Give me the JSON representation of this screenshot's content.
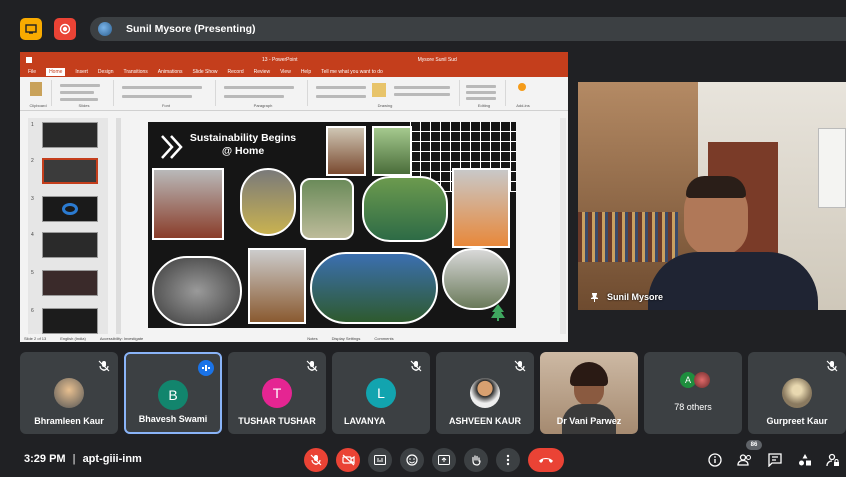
{
  "presenting_bar": {
    "title": "Sunil Mysore (Presenting)"
  },
  "powerpoint": {
    "title": "13 - PowerPoint",
    "user": "Mysore Sunil Sud",
    "menu": [
      "File",
      "Home",
      "Insert",
      "Design",
      "Transitions",
      "Animations",
      "Slide Show",
      "Record",
      "Review",
      "View",
      "Help",
      "Tell me what you want to do"
    ],
    "active_menu": "Home",
    "ribbon_groups": [
      "Clipboard",
      "Slides",
      "Font",
      "Paragraph",
      "Drawing",
      "Editing",
      "Add-ins"
    ],
    "slide_numbers": [
      "1",
      "2",
      "3",
      "4",
      "5",
      "6"
    ],
    "slide_title": "Sustainability Begins @ Home",
    "status": [
      "Slide 2 of 13",
      "English (India)",
      "Accessibility: Investigate",
      "Notes",
      "Display Settings",
      "Comments"
    ]
  },
  "presenter": {
    "name": "Sunil Mysore"
  },
  "participants": [
    {
      "name": "Bhramleen Kaur",
      "initial": "",
      "avatar_color": "#6d6d6d",
      "muted": true,
      "speaking": false
    },
    {
      "name": "Bhavesh Swami",
      "initial": "B",
      "avatar_color": "#12856d",
      "muted": false,
      "speaking": true
    },
    {
      "name": "TUSHAR TUSHAR",
      "initial": "T",
      "avatar_color": "#e52592",
      "muted": true,
      "speaking": false
    },
    {
      "name": "LAVANYA",
      "initial": "L",
      "avatar_color": "#12a4af",
      "muted": true,
      "speaking": false
    },
    {
      "name": "ASHVEEN KAUR",
      "initial": "",
      "avatar_color": "#bcbcbc",
      "muted": true,
      "speaking": false
    },
    {
      "name": "Dr Vani Parwez",
      "initial": "",
      "avatar_color": "",
      "muted": false,
      "speaking": false
    },
    {
      "name": "78 others",
      "initial": "A",
      "avatar_color": "#1e8e3e",
      "muted": false,
      "speaking": false
    },
    {
      "name": "Gurpreet Kaur",
      "initial": "",
      "avatar_color": "#8a7a60",
      "muted": true,
      "speaking": false
    }
  ],
  "bottom_bar": {
    "time": "3:29 PM",
    "separator": "|",
    "meeting_code": "apt-giii-inm",
    "participant_count": "86"
  },
  "colors": {
    "background": "#202124",
    "tile": "#3c4043",
    "danger": "#ea4335",
    "accent": "#8ab4f8"
  }
}
